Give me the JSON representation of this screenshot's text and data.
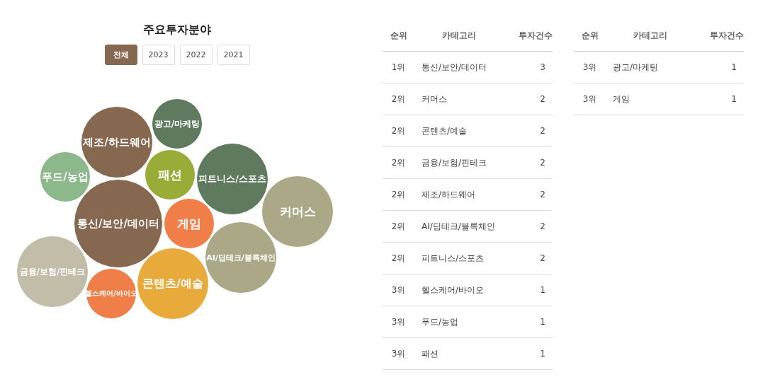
{
  "title": "주요투자분야",
  "tabs": [
    {
      "label": "전체",
      "selected": true
    },
    {
      "label": "2023",
      "selected": false
    },
    {
      "label": "2022",
      "selected": false
    },
    {
      "label": "2021",
      "selected": false
    }
  ],
  "bubbles": [
    {
      "label": "제조/하드웨어",
      "color": "#86674f"
    },
    {
      "label": "광고/마케팅",
      "color": "#5f7a5e"
    },
    {
      "label": "푸드/농업",
      "color": "#8cb88c"
    },
    {
      "label": "패션",
      "color": "#98ac37"
    },
    {
      "label": "피트니스/스포츠",
      "color": "#5f7a5e"
    },
    {
      "label": "통신/보안/데이터",
      "color": "#86674f"
    },
    {
      "label": "게임",
      "color": "#ef7e49"
    },
    {
      "label": "커머스",
      "color": "#aba887"
    },
    {
      "label": "금융/보험/핀테크",
      "color": "#c1bda8"
    },
    {
      "label": "헬스케어/바이오",
      "color": "#ef7e49"
    },
    {
      "label": "콘텐츠/예술",
      "color": "#e8ab3b"
    },
    {
      "label": "AI/딥테크/블록체인",
      "color": "#aba887"
    }
  ],
  "tables": [
    {
      "columns": [
        "순위",
        "카테고리",
        "투자건수"
      ],
      "rows": [
        [
          "1위",
          "통신/보안/데이터",
          "3"
        ],
        [
          "2위",
          "커머스",
          "2"
        ],
        [
          "2위",
          "콘텐츠/예술",
          "2"
        ],
        [
          "2위",
          "금융/보험/핀테크",
          "2"
        ],
        [
          "2위",
          "제조/하드웨어",
          "2"
        ],
        [
          "2위",
          "AI/딥테크/블록체인",
          "2"
        ],
        [
          "2위",
          "피트니스/스포츠",
          "2"
        ],
        [
          "3위",
          "헬스케어/바이오",
          "1"
        ],
        [
          "3위",
          "푸드/농업",
          "1"
        ],
        [
          "3위",
          "패션",
          "1"
        ]
      ]
    },
    {
      "columns": [
        "순위",
        "카테고리",
        "투자건수"
      ],
      "rows": [
        [
          "3위",
          "광고/마케팅",
          "1"
        ],
        [
          "3위",
          "게임",
          "1"
        ]
      ]
    }
  ]
}
